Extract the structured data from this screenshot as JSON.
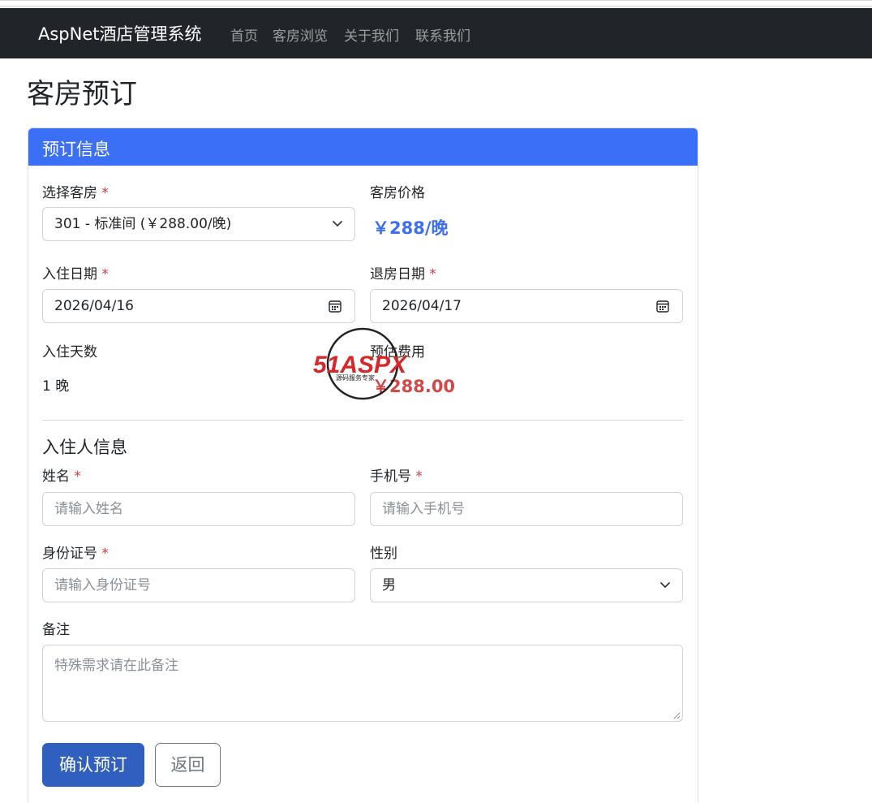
{
  "navbar": {
    "brand": "AspNet酒店管理系统",
    "links": [
      "首页",
      "客房浏览",
      "关于我们",
      "联系我们"
    ]
  },
  "page": {
    "title": "客房预订"
  },
  "card": {
    "header": "预订信息",
    "room_select": {
      "label": "选择客房",
      "required_mark": "*",
      "value": "301 - 标准间 (￥288.00/晚)",
      "icon": "chevron-down-icon"
    },
    "room_price": {
      "label": "客房价格",
      "value": "￥288/晚"
    },
    "checkin": {
      "label": "入住日期",
      "required_mark": "*",
      "value": "2026/04/16",
      "icon": "calendar-icon"
    },
    "checkout": {
      "label": "退房日期",
      "required_mark": "*",
      "value": "2026/04/17",
      "icon": "calendar-icon"
    },
    "nights": {
      "label": "入住天数",
      "value": "1 晚"
    },
    "estimate": {
      "label": "预估费用",
      "value": "￥288.00"
    },
    "guest_section": {
      "title": "入住人信息",
      "name": {
        "label": "姓名",
        "required_mark": "*",
        "placeholder": "请输入姓名"
      },
      "phone": {
        "label": "手机号",
        "required_mark": "*",
        "placeholder": "请输入手机号"
      },
      "id_number": {
        "label": "身份证号",
        "required_mark": "*",
        "placeholder": "请输入身份证号"
      },
      "gender": {
        "label": "性别",
        "value": "男",
        "icon": "chevron-down-icon"
      },
      "remark": {
        "label": "备注",
        "placeholder": "特殊需求请在此备注"
      }
    },
    "actions": {
      "confirm": "确认预订",
      "back": "返回"
    }
  },
  "watermark": {
    "logo_text": "51ASPX",
    "tagline": "源码服务专家"
  },
  "colors": {
    "navbar_bg": "#212529",
    "header_blue": "#3b6ff5",
    "price_blue": "#3b6ff5",
    "estimate_red": "#d14a47",
    "required_red": "#dc3545",
    "primary_button": "#2f5fbf"
  }
}
